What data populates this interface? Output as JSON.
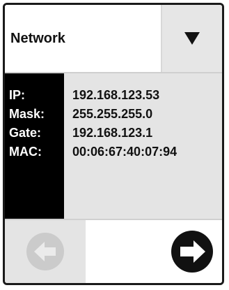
{
  "dropdown": {
    "selected": "Network",
    "toggle_icon": "triangle-down-icon"
  },
  "network_info": {
    "rows": [
      {
        "label": "IP:",
        "value": "192.168.123.53"
      },
      {
        "label": "Mask:",
        "value": "255.255.255.0"
      },
      {
        "label": "Gate:",
        "value": "192.168.123.1"
      },
      {
        "label": "MAC:",
        "value": "00:06:67:40:07:94"
      }
    ]
  },
  "navigation": {
    "back_icon": "arrow-left-circle-icon",
    "back_enabled": false,
    "next_icon": "arrow-right-circle-icon",
    "next_enabled": true
  },
  "colors": {
    "label_column_bg": "#000000",
    "panel_bg": "#e4e4e4",
    "disabled_icon": "#c8c8c8",
    "enabled_icon": "#111111"
  }
}
